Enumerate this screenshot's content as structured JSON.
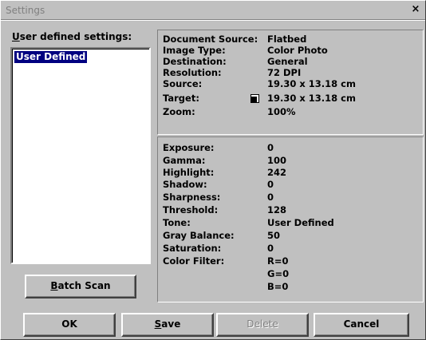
{
  "window": {
    "title": "Settings",
    "close_glyph": "×"
  },
  "user_settings": {
    "label_accel": "U",
    "label_rest": "ser defined settings:",
    "items": [
      "User Defined"
    ]
  },
  "document_info": [
    {
      "label": "Document Source:",
      "value": "Flatbed"
    },
    {
      "label": "Image Type:",
      "value": "Color Photo"
    },
    {
      "label": "Destination:",
      "value": "General"
    },
    {
      "label": "Resolution:",
      "value": "72 DPI"
    },
    {
      "label": "Source:",
      "value": "19.30 x 13.18 cm"
    },
    {
      "label": "Target:",
      "value": "19.30 x 13.18 cm"
    },
    {
      "label": "Zoom:",
      "value": "100%"
    }
  ],
  "adjustments": [
    {
      "label": "Exposure:",
      "value": "0"
    },
    {
      "label": "Gamma:",
      "value": "100"
    },
    {
      "label": "Highlight:",
      "value": "242"
    },
    {
      "label": "Shadow:",
      "value": "0"
    },
    {
      "label": "Sharpness:",
      "value": "0"
    },
    {
      "label": "Threshold:",
      "value": "128"
    },
    {
      "label": "Tone:",
      "value": "User Defined"
    },
    {
      "label": "Gray Balance:",
      "value": "50"
    },
    {
      "label": "Saturation:",
      "value": "0"
    },
    {
      "label": "Color Filter:",
      "value": "R=0"
    },
    {
      "label": "",
      "value": "G=0"
    },
    {
      "label": "",
      "value": "B=0"
    }
  ],
  "buttons": {
    "batch_scan": {
      "accel": "B",
      "rest": "atch Scan"
    },
    "ok": "OK",
    "save": {
      "accel": "S",
      "rest": "ave"
    },
    "delete": "Delete",
    "cancel": "Cancel"
  }
}
